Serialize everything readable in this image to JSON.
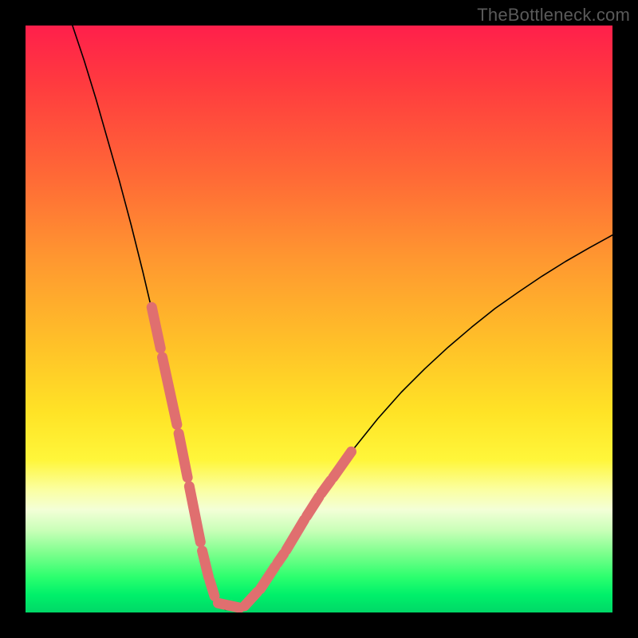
{
  "watermark": "TheBottleneck.com",
  "colors": {
    "frame": "#000000",
    "curve": "#000000",
    "marker": "#e06f6f",
    "watermark_text": "#5a5a5a"
  },
  "chart_data": {
    "type": "line",
    "title": "",
    "xlabel": "",
    "ylabel": "",
    "xlim": [
      0,
      100
    ],
    "ylim": [
      0,
      100
    ],
    "x": [
      8,
      10,
      12,
      14,
      16,
      18,
      20,
      22,
      24,
      26,
      28,
      29,
      30,
      31,
      32,
      33,
      34,
      35,
      37,
      40,
      44,
      48,
      52,
      56,
      60,
      64,
      68,
      72,
      76,
      80,
      84,
      88,
      92,
      96,
      100
    ],
    "values": [
      100,
      94,
      87.5,
      80.5,
      73.5,
      66,
      58,
      49.5,
      40.5,
      31,
      21,
      16,
      11,
      7,
      3.5,
      1.5,
      0.5,
      0.5,
      1,
      4,
      10,
      16.5,
      22.5,
      28,
      33,
      37.5,
      41.5,
      45.2,
      48.6,
      51.8,
      54.6,
      57.3,
      59.8,
      62.1,
      64.3
    ],
    "marker_segments": [
      {
        "x0": 21.5,
        "y0": 52,
        "x1": 23.0,
        "y1": 45
      },
      {
        "x0": 23.3,
        "y0": 43.5,
        "x1": 25.8,
        "y1": 32
      },
      {
        "x0": 26.1,
        "y0": 30.5,
        "x1": 27.6,
        "y1": 23
      },
      {
        "x0": 27.9,
        "y0": 21.5,
        "x1": 29.8,
        "y1": 12
      },
      {
        "x0": 30.1,
        "y0": 10.5,
        "x1": 31.2,
        "y1": 6
      },
      {
        "x0": 31.4,
        "y0": 5.4,
        "x1": 32.2,
        "y1": 2.8
      },
      {
        "x0": 32.8,
        "y0": 1.6,
        "x1": 36.5,
        "y1": 0.8
      },
      {
        "x0": 37.3,
        "y0": 1.1,
        "x1": 39.5,
        "y1": 3.5
      },
      {
        "x0": 40.0,
        "y0": 4.0,
        "x1": 42.5,
        "y1": 7.8
      },
      {
        "x0": 42.9,
        "y0": 8.4,
        "x1": 44.0,
        "y1": 10.0
      },
      {
        "x0": 44.4,
        "y0": 10.6,
        "x1": 47.5,
        "y1": 15.8
      },
      {
        "x0": 47.9,
        "y0": 16.4,
        "x1": 50.0,
        "y1": 19.7
      },
      {
        "x0": 50.4,
        "y0": 20.3,
        "x1": 52.0,
        "y1": 22.5
      },
      {
        "x0": 52.4,
        "y0": 23.0,
        "x1": 55.5,
        "y1": 27.4
      }
    ],
    "grid": false,
    "legend": false
  }
}
